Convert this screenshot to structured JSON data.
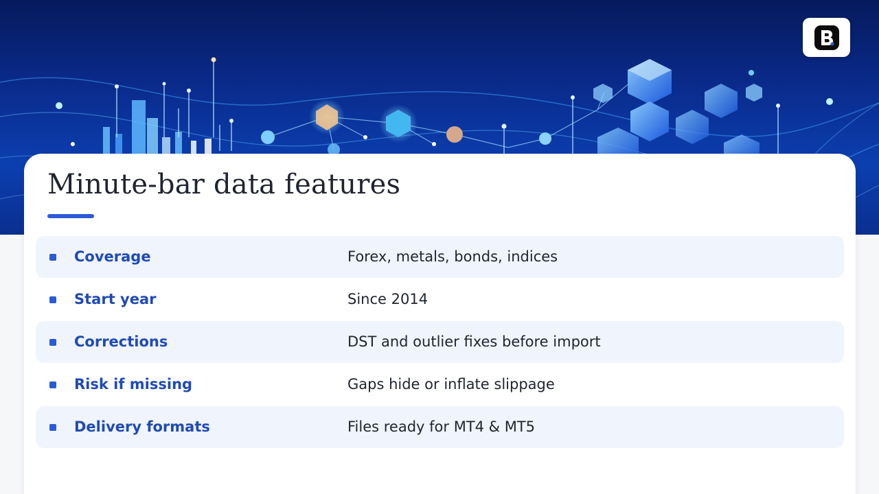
{
  "slide": {
    "title": "Minute-bar data features",
    "logo_icon": "brand-b-logo-icon",
    "banner_image": "abstract-data-network-illustration",
    "accent_color": "#2a5bd7",
    "label_color": "#1f4bb5"
  },
  "rows": [
    {
      "label": "Coverage",
      "value": "Forex, metals, bonds, indices"
    },
    {
      "label": "Start year",
      "value": "Since 2014"
    },
    {
      "label": "Corrections",
      "value": "DST and outlier fixes before import"
    },
    {
      "label": "Risk if missing",
      "value": "Gaps hide or inflate slippage"
    },
    {
      "label": "Delivery formats",
      "value": "Files ready for MT4 & MT5"
    }
  ]
}
